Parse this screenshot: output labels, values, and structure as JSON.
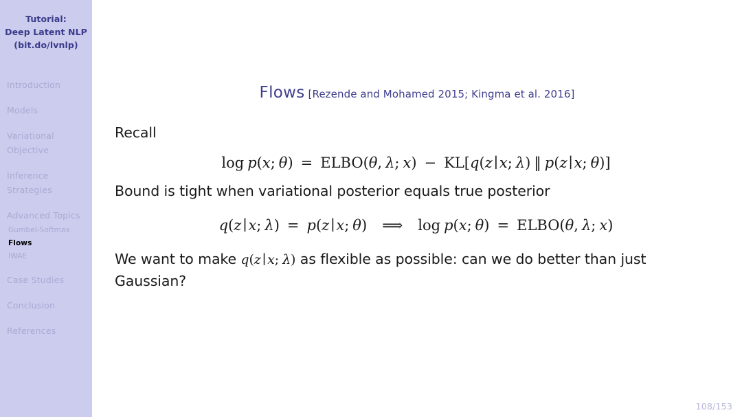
{
  "sidebar": {
    "header": {
      "line1": "Tutorial:",
      "line2": "Deep Latent NLP",
      "line3": "(bit.do/lvnlp)"
    },
    "sections": [
      {
        "label": "Introduction"
      },
      {
        "label": "Models"
      },
      {
        "label_line1": "Variational",
        "label_line2": "Objective"
      },
      {
        "label_line1": "Inference",
        "label_line2": "Strategies"
      },
      {
        "label": "Advanced Topics"
      },
      {
        "label": "Case Studies"
      },
      {
        "label": "Conclusion"
      },
      {
        "label": "References"
      }
    ],
    "subitems": [
      {
        "label": "Gumbel-Softmax",
        "active": false
      },
      {
        "label": "Flows",
        "active": true
      },
      {
        "label": "IWAE",
        "active": false
      }
    ]
  },
  "slide": {
    "title_main": "Flows",
    "title_citation": "[Rezende and Mohamed 2015; Kingma et al. 2016]",
    "para1": "Recall",
    "equation1": {
      "full_text": "log p(x; θ) = ELBO(θ, λ; x) − KL[q(z | x; λ) ‖ p(z | x; θ)]"
    },
    "para2": "Bound is tight when variational posterior equals true posterior",
    "equation2": {
      "full_text": "q(z | x; λ) = p(z | x; θ) ⟹ log p(x; θ) = ELBO(θ, λ; x)"
    },
    "para3_before": "We want to make ",
    "para3_math": "q(z | x; λ)",
    "para3_after": " as flexible as possible: can we do better than just Gaussian?",
    "page_number": "108/153"
  },
  "colors": {
    "sidebar_bg": "#ccccee",
    "sidebar_header_text": "#3b3b8c",
    "sidebar_item_text": "#a9a9d4",
    "sidebar_active_text": "#000000",
    "title_text": "#3e3e8f",
    "body_text": "#1a1a1a",
    "page_number_text": "#b6b6da",
    "main_bg": "#ffffff"
  }
}
